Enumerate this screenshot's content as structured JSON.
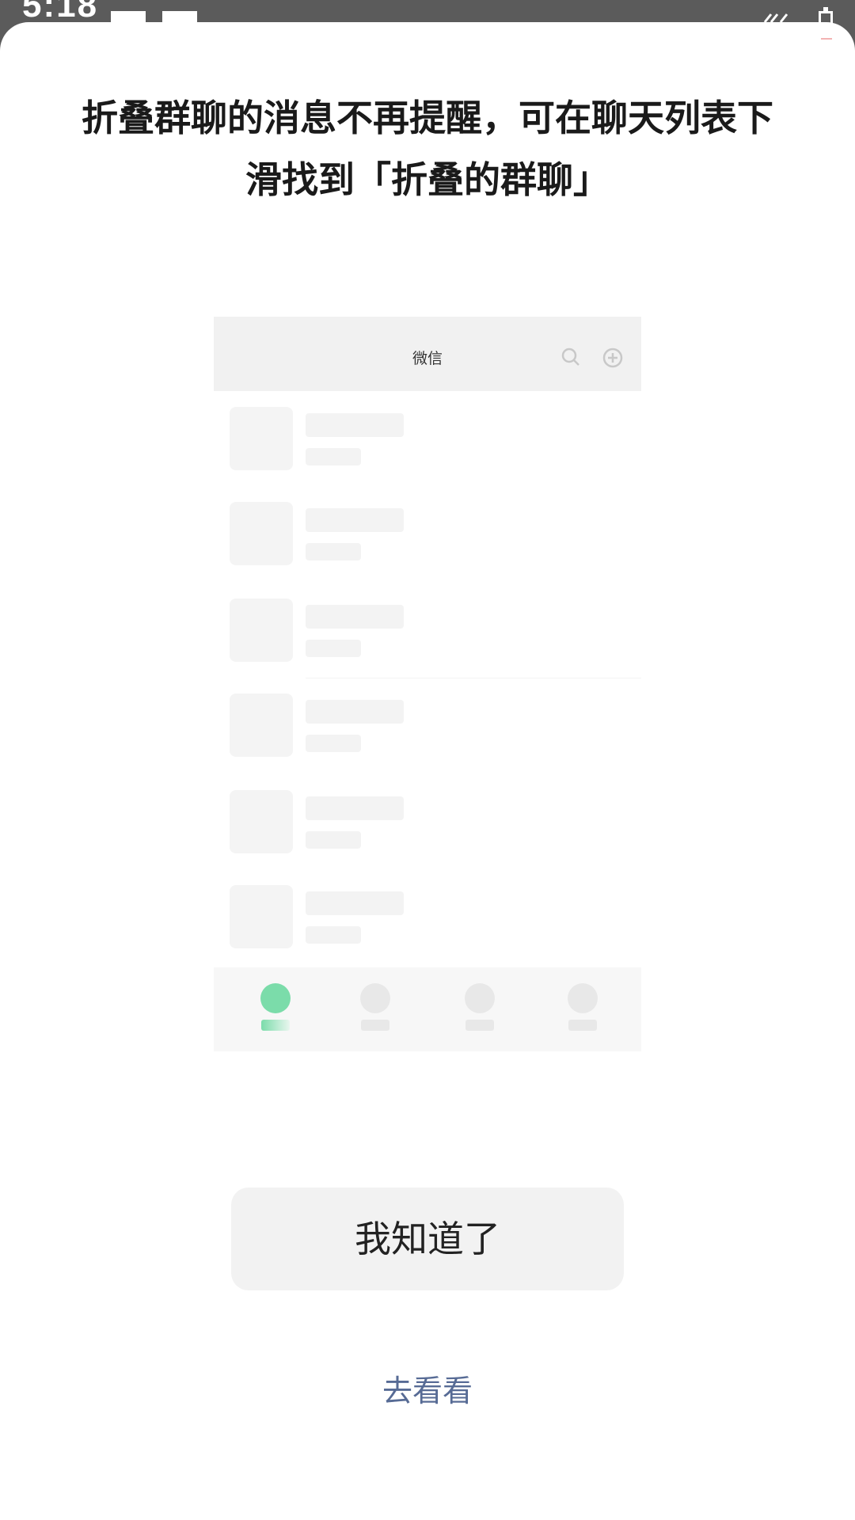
{
  "status_bar": {
    "time": "5:18"
  },
  "dialog": {
    "headline": "折叠群聊的消息不再提醒，可在聊天列表下滑找到「折叠的群聊」",
    "primary_button": "我知道了",
    "secondary_link": "去看看"
  },
  "illustration": {
    "title": "微信",
    "header_icons": [
      "search-icon",
      "add-circle-icon"
    ],
    "rows": 6,
    "tabs": 4,
    "active_tab_index": 0
  },
  "colors": {
    "link": "#576b95",
    "active_tab": "#7bdcaa",
    "button_bg": "#f2f2f2"
  }
}
